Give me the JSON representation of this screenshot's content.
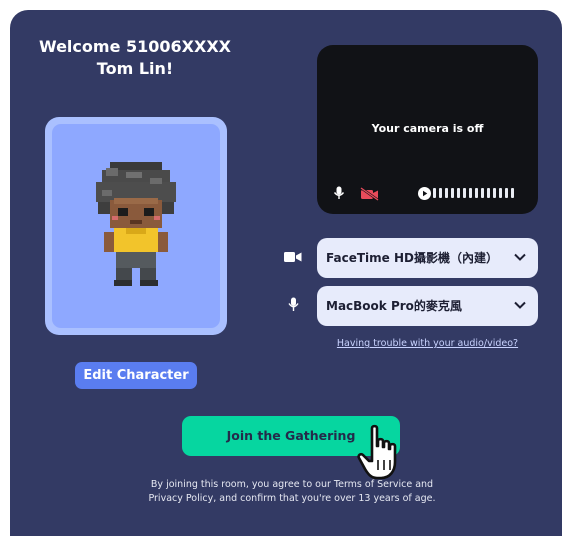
{
  "welcome": {
    "line1": "Welcome 51006XXXX",
    "line2": "Tom Lin!"
  },
  "edit_character_label": "Edit Character",
  "camera_preview": {
    "status_text": "Your camera is off"
  },
  "devices": {
    "camera_select": "FaceTime HD攝影機（內建）",
    "microphone_select": "MacBook Pro的麥克風"
  },
  "trouble_link": "Having trouble with your audio/video?",
  "join_button": "Join the Gathering",
  "legal": {
    "line1": "By joining this room, you agree to our Terms of Service and",
    "line2": "Privacy Policy, and confirm that you're over 13 years of age."
  },
  "colors": {
    "background": "#333a64",
    "join_accent": "#06d6a0",
    "edit_button": "#5a7df0",
    "camera_off_icon": "#e94b5b"
  },
  "icons": [
    "microphone-icon",
    "camera-off-icon",
    "play-icon",
    "video-camera-icon",
    "chevron-down-icon",
    "hand-cursor-icon"
  ]
}
